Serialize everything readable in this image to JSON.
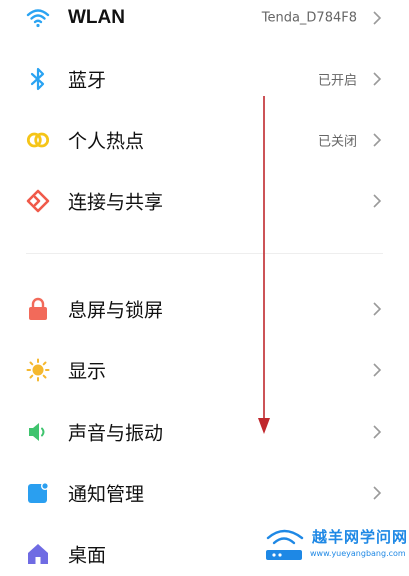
{
  "settings": {
    "wlan": {
      "label": "WLAN",
      "value": "Tenda_D784F8",
      "icon": "wifi-icon"
    },
    "bluetooth": {
      "label": "蓝牙",
      "value": "已开启",
      "icon": "bluetooth-icon"
    },
    "hotspot": {
      "label": "个人热点",
      "value": "已关闭",
      "icon": "hotspot-icon"
    },
    "connection": {
      "label": "连接与共享",
      "icon": "connection-share-icon"
    },
    "lockscreen": {
      "label": "息屏与锁屏",
      "icon": "lock-icon"
    },
    "display": {
      "label": "显示",
      "icon": "sun-icon"
    },
    "sound": {
      "label": "声音与振动",
      "icon": "speaker-icon"
    },
    "notifications": {
      "label": "通知管理",
      "icon": "notification-icon"
    },
    "desktop": {
      "label": "桌面",
      "icon": "home-icon"
    }
  },
  "colors": {
    "wifi": "#2aa3f2",
    "bluetooth": "#2aa3f2",
    "hotspot": "#f5c518",
    "connection": "#f05a4a",
    "lock": "#f26a5a",
    "display": "#f5b82e",
    "sound": "#3fc46e",
    "notification": "#2a9ff0",
    "home": "#6f6be3",
    "annotation_arrow": "#c0282d",
    "watermark": "#1e88e5"
  },
  "watermark": {
    "text": "越羊网学问网",
    "url": "www.yueyangbang.com"
  }
}
